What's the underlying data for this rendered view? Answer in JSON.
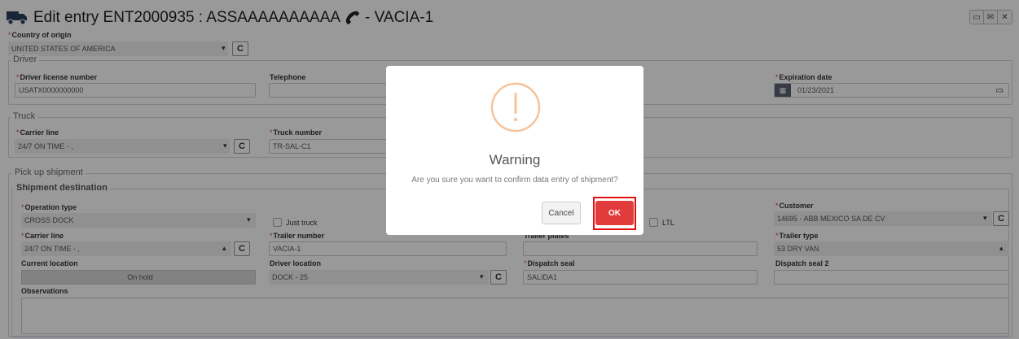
{
  "header": {
    "title": "Edit entry ENT2000935 : ASSAAAAAAAAAA",
    "title_suffix": "- VACIA-1"
  },
  "window_buttons": [
    "save-icon",
    "mail-icon",
    "close-icon"
  ],
  "origin": {
    "label": "Country of origin",
    "value": "UNITED STATES OF AMERICA"
  },
  "driver": {
    "legend": "Driver",
    "license_label": "Driver license number",
    "license_value": "USATX0000000000",
    "telephone_label": "Telephone",
    "telephone_value": "",
    "expiration_label": "Expiration date",
    "expiration_value": "01/23/2021"
  },
  "truck": {
    "legend": "Truck",
    "carrier_label": "Carrier line",
    "carrier_value": "24/7 ON TIME - ,",
    "truck_number_label": "Truck number",
    "truck_number_value": "TR-SAL-C1"
  },
  "pickup": {
    "legend": "Pick up shipment",
    "destination_legend": "Shipment destination",
    "operation_label": "Operation type",
    "operation_value": "CROSS DOCK",
    "just_truck_label": "Just truck",
    "ltl_label": "LTL",
    "customer_label": "Customer",
    "customer_value": "14695 - ABB MEXICO SA DE CV",
    "carrier_label": "Carrier line",
    "carrier_value": "24/7 ON TIME - ,",
    "trailer_number_label": "Trailer number",
    "trailer_number_value": "VACIA-1",
    "trailer_plates_label": "Trailer plates",
    "trailer_plates_value": "",
    "trailer_type_label": "Trailer type",
    "trailer_type_value": "53 DRY VAN",
    "current_location_label": "Current location",
    "current_location_value": "On hold",
    "driver_location_label": "Driver location",
    "driver_location_value": "DOCK - 25",
    "dispatch_seal_label": "Dispatch seal",
    "dispatch_seal_value": "SALIDA1",
    "dispatch_seal2_label": "Dispatch seal 2",
    "dispatch_seal2_value": "",
    "observations_label": "Observations"
  },
  "modal": {
    "title": "Warning",
    "message": "Are you sure you want to confirm data entry of shipment?",
    "cancel_label": "Cancel",
    "ok_label": "OK",
    "icon": "warning-exclamation-icon",
    "icon_color": "#f6c39a",
    "ok_color": "#e23b3b",
    "highlight_color": "#e01010"
  }
}
